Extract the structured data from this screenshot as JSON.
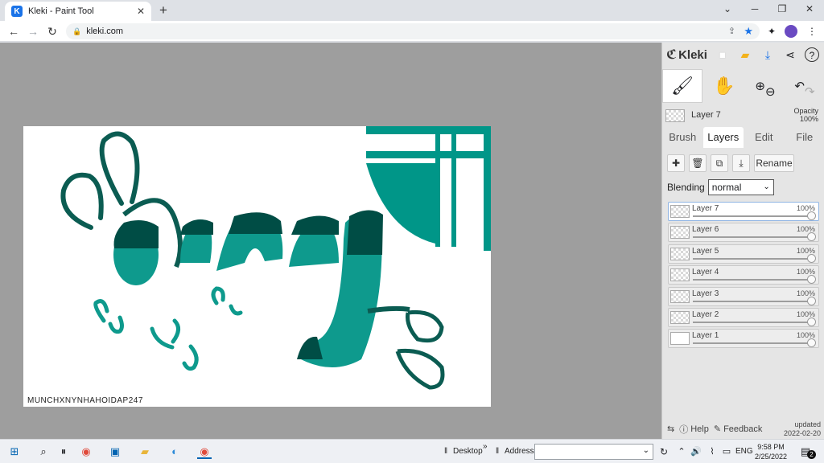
{
  "browser": {
    "tab_title": "Kleki - Paint Tool",
    "favicon_letter": "K",
    "url": "kleki.com",
    "icons": [
      "close-icon",
      "plus-icon",
      "chevron-down-icon",
      "minimize-icon",
      "restore-icon",
      "close-icon"
    ]
  },
  "app": {
    "logo": "Kleki",
    "canvas_signature": "MUNCHXNYNHAHOIDAP247",
    "accent_color": "#009688"
  },
  "panel": {
    "current_layer": "Layer 7",
    "opacity_label": "Opacity",
    "opacity_value": "100%",
    "tabs": [
      {
        "label": "Brush"
      },
      {
        "label": "Layers"
      },
      {
        "label": "Edit"
      },
      {
        "label": "File"
      }
    ],
    "rename_label": "Rename",
    "blending_label": "Blending",
    "blending_value": "normal",
    "layers": [
      {
        "name": "Layer 7",
        "opacity": "100%"
      },
      {
        "name": "Layer 6",
        "opacity": "100%"
      },
      {
        "name": "Layer 5",
        "opacity": "100%"
      },
      {
        "name": "Layer 4",
        "opacity": "100%"
      },
      {
        "name": "Layer 3",
        "opacity": "100%"
      },
      {
        "name": "Layer 2",
        "opacity": "100%"
      },
      {
        "name": "Layer 1",
        "opacity": "100%"
      }
    ],
    "help_label": "Help",
    "feedback_label": "Feedback",
    "updated_label": "updated",
    "updated_date": "2022-02-20"
  },
  "taskbar": {
    "desktop_label": "Desktop",
    "address_label": "Address",
    "language": "ENG",
    "time": "9:58 PM",
    "date": "2/25/2022",
    "notification_count": "2"
  }
}
